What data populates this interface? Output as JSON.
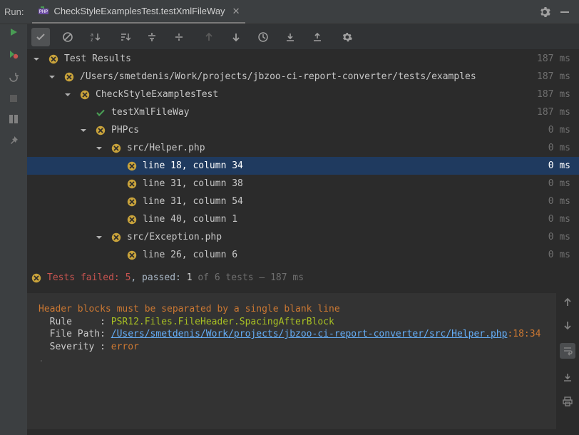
{
  "titlebar": {
    "run_label": "Run:",
    "tab_title": "CheckStyleExamplesTest.testXmlFileWay"
  },
  "tree": {
    "root": {
      "label": "Test Results",
      "timing": "187 ms"
    },
    "nodes": [
      {
        "indent": 1,
        "arrow": true,
        "status": "fail",
        "label": "/Users/smetdenis/Work/projects/jbzoo-ci-report-converter/tests/examples",
        "timing": "187 ms"
      },
      {
        "indent": 2,
        "arrow": true,
        "status": "fail",
        "label": "CheckStyleExamplesTest",
        "timing": "187 ms"
      },
      {
        "indent": 3,
        "arrow": false,
        "status": "pass",
        "label": "testXmlFileWay",
        "timing": "187 ms"
      },
      {
        "indent": 3,
        "arrow": true,
        "status": "fail",
        "label": "PHPcs",
        "timing": "0 ms"
      },
      {
        "indent": 4,
        "arrow": true,
        "status": "fail",
        "label": "src/Helper.php",
        "timing": "0 ms"
      },
      {
        "indent": 5,
        "arrow": false,
        "status": "fail",
        "label": "line 18, column 34",
        "timing": "0 ms",
        "selected": true
      },
      {
        "indent": 5,
        "arrow": false,
        "status": "fail",
        "label": "line 31, column 38",
        "timing": "0 ms"
      },
      {
        "indent": 5,
        "arrow": false,
        "status": "fail",
        "label": "line 31, column 54",
        "timing": "0 ms"
      },
      {
        "indent": 5,
        "arrow": false,
        "status": "fail",
        "label": "line 40, column 1",
        "timing": "0 ms"
      },
      {
        "indent": 4,
        "arrow": true,
        "status": "fail",
        "label": "src/Exception.php",
        "timing": "0 ms"
      },
      {
        "indent": 5,
        "arrow": false,
        "status": "fail",
        "label": "line 26, column 6",
        "timing": "0 ms"
      }
    ]
  },
  "summary": {
    "failed_label": "Tests failed:",
    "failed_n": "5",
    "sep": ", passed:",
    "passed_n": "1",
    "tail": "of 6 tests – 187 ms"
  },
  "console": {
    "msg": "Header blocks must be separated by a single blank line",
    "rule_key": "  Rule",
    "dots": "     ",
    "colon": ": ",
    "rule_val": "PSR12.Files.FileHeader.SpacingAfterBlock",
    "path_key": "  File Path",
    "path_val": "/Users/smetdenis/Work/projects/jbzoo-ci-report-converter/src/Helper.php",
    "path_suffix": ":18:34",
    "sev_key": "  Severity ",
    "sev_val": "error"
  }
}
